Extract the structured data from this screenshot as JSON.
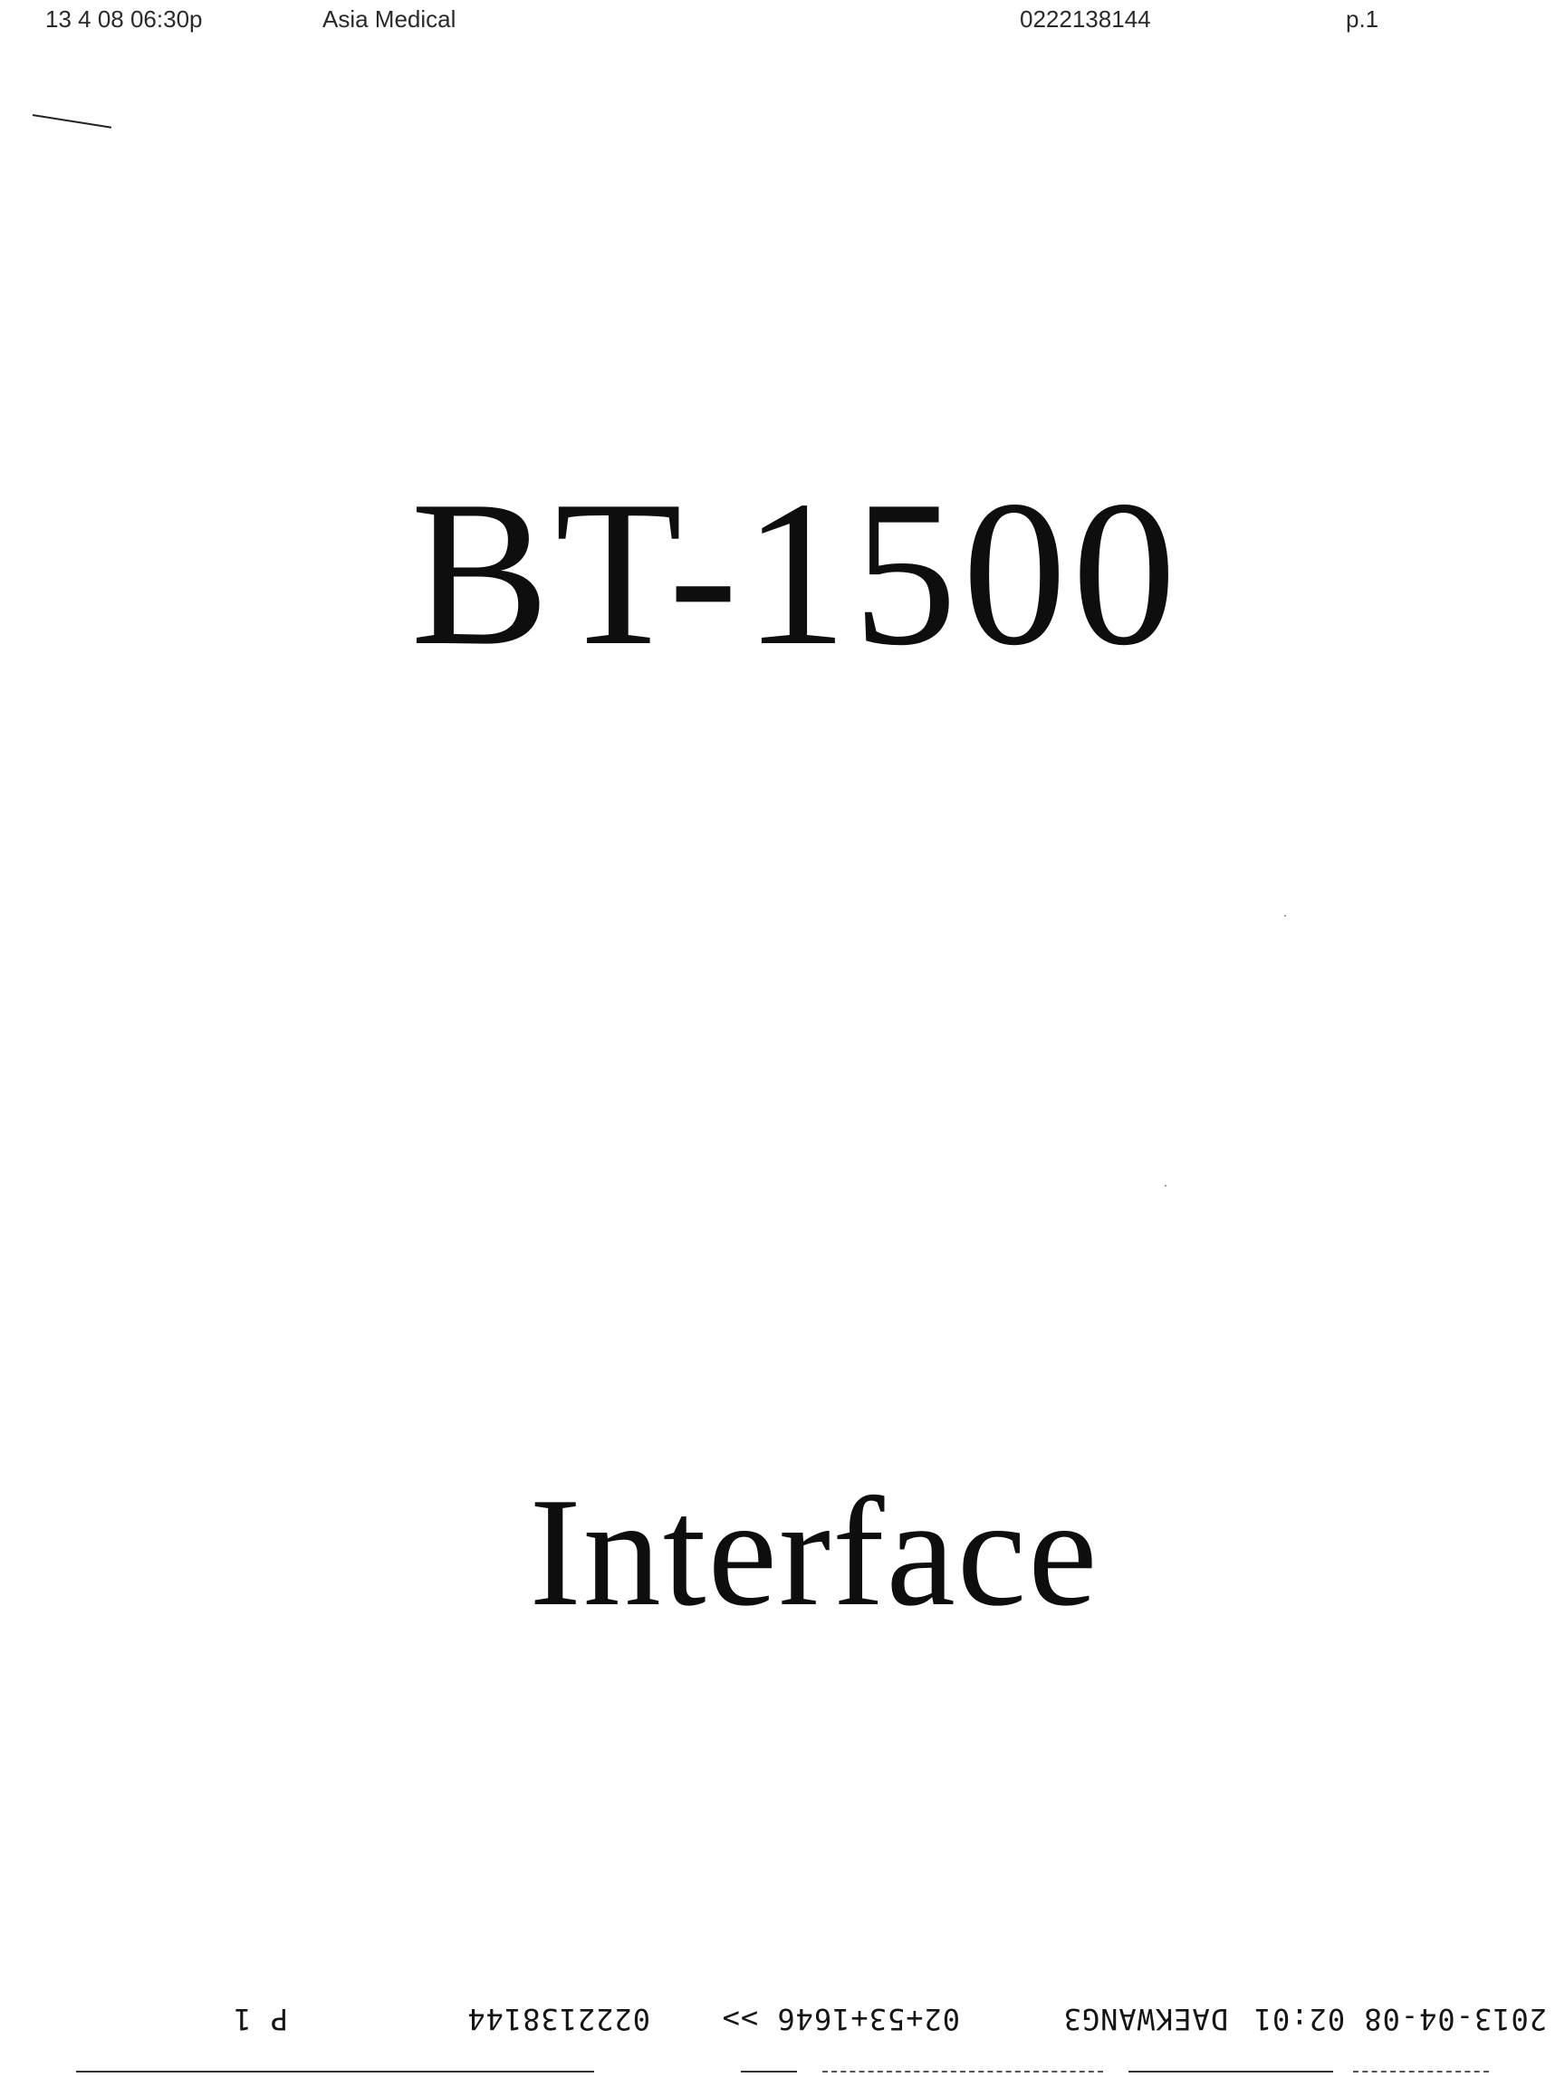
{
  "fax_header": {
    "datetime": "13 4 08 06:30p",
    "sender": "Asia Medical",
    "fax_number": "0222138144",
    "page": "p.1"
  },
  "document": {
    "title": "BT-1500",
    "subtitle": "Interface"
  },
  "fax_footer_inverted": {
    "timestamp": "2013-04-08 02:01",
    "station": "DAEKWANG3",
    "routing": "02+53+1646 >>",
    "fax_number": "0222138144",
    "page": "P 1"
  }
}
